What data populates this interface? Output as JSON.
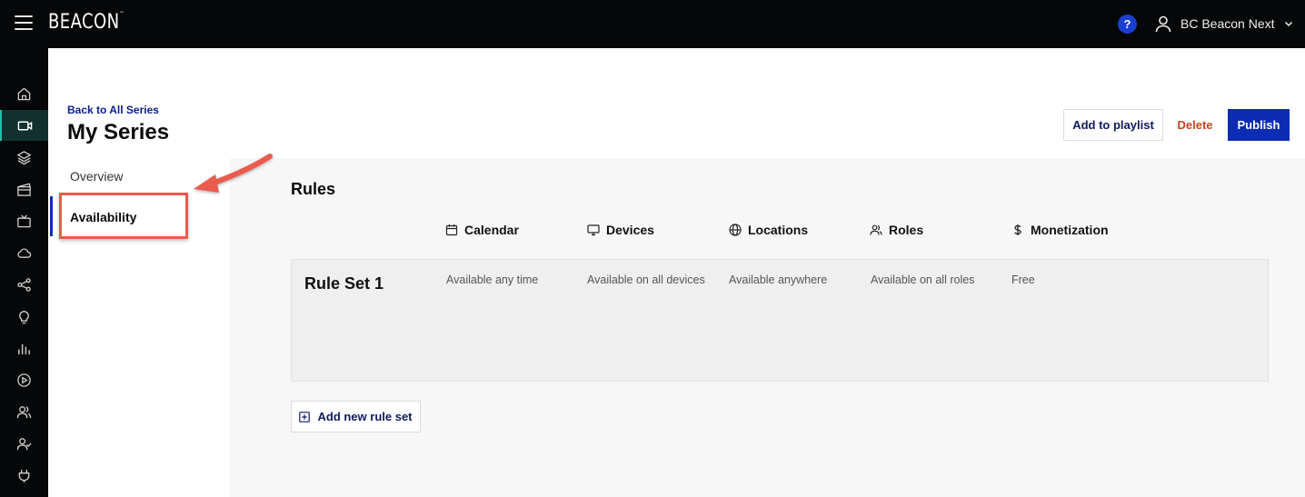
{
  "app": {
    "logo_text": "BEACON",
    "logo_mark": "™"
  },
  "topbar": {
    "help_label": "?",
    "user_name": "BC Beacon Next",
    "icons": [
      "hamburger-menu-icon",
      "help-icon",
      "user-icon",
      "chevron-down-icon"
    ]
  },
  "rail": {
    "items": [
      {
        "icon": "home-icon"
      },
      {
        "icon": "video-camera-icon",
        "active": true
      },
      {
        "icon": "layers-icon"
      },
      {
        "icon": "film-clapper-icon"
      },
      {
        "icon": "tv-icon"
      },
      {
        "icon": "cloud-icon"
      },
      {
        "icon": "share-nodes-icon"
      },
      {
        "icon": "lightbulb-icon"
      },
      {
        "icon": "bar-chart-icon"
      },
      {
        "icon": "play-circle-icon"
      },
      {
        "icon": "users-icon"
      },
      {
        "icon": "user-check-icon"
      },
      {
        "icon": "plug-icon"
      }
    ]
  },
  "header": {
    "back_link": "Back to All Series",
    "title": "My Series",
    "add_to_playlist": "Add to playlist",
    "delete": "Delete",
    "publish": "Publish"
  },
  "side_nav": {
    "items": [
      {
        "label": "Overview",
        "active": false
      },
      {
        "label": "Availability",
        "active": true
      }
    ]
  },
  "rules": {
    "title": "Rules",
    "columns": [
      {
        "label": "Calendar",
        "icon": "calendar-icon"
      },
      {
        "label": "Devices",
        "icon": "monitor-icon"
      },
      {
        "label": "Locations",
        "icon": "globe-icon"
      },
      {
        "label": "Roles",
        "icon": "users-icon"
      },
      {
        "label": "Monetization",
        "icon": "dollar-icon"
      }
    ],
    "rule_sets": [
      {
        "name": "Rule Set 1",
        "values": [
          "Available any time",
          "Available on all devices",
          "Available anywhere",
          "Available on all roles",
          "Free"
        ]
      }
    ],
    "add_button": "Add new rule set"
  },
  "colors": {
    "topbar_bg": "#050708",
    "accent_blue": "#0d2cb4",
    "link_blue": "#0a1e8c",
    "delete_orange": "#c6451f",
    "annotation_red": "#ea5b4e",
    "rail_active": "#1fbfa8"
  }
}
